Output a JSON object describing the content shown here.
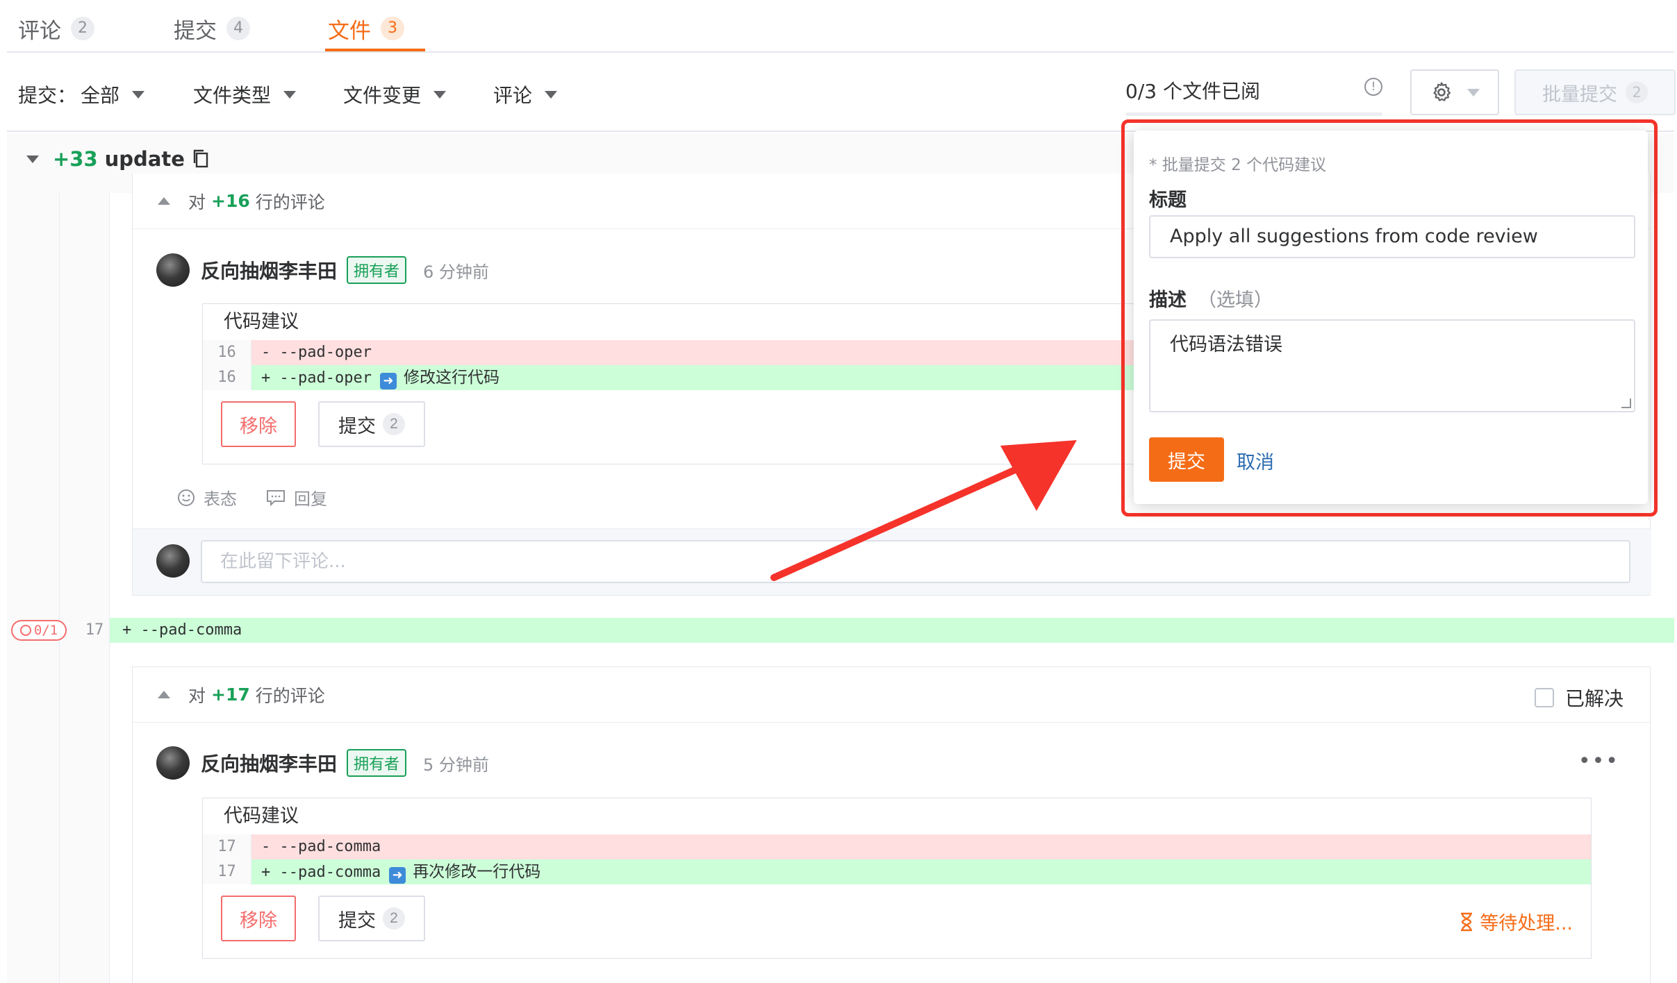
{
  "tabs": [
    {
      "label": "评论",
      "count": "2"
    },
    {
      "label": "提交",
      "count": "4"
    },
    {
      "label": "文件",
      "count": "3"
    }
  ],
  "filters": {
    "commit_label": "提交：",
    "commit_value": "全部",
    "file_type": "文件类型",
    "file_change": "文件变更",
    "comment": "评论"
  },
  "viewed_progress": "0/3 个文件已阅",
  "batch_submit": {
    "label": "批量提交",
    "count": "2"
  },
  "file": {
    "add_count": "+33",
    "name": "update"
  },
  "thread1": {
    "header_prefix": "对",
    "line_ref": "+16",
    "header_suffix": "行的评论",
    "author": "反向抽烟李丰田",
    "owner_tag": "拥有者",
    "time": "6 分钟前",
    "suggestion_title": "代码建议",
    "del_line_no": "16",
    "del_code": "- --pad-oper",
    "add_line_no": "16",
    "add_code": "+ --pad-oper",
    "add_note": "修改这行代码",
    "remove_label": "移除",
    "apply_label": "提交",
    "apply_count": "2",
    "react_label": "表态",
    "reply_label": "回复",
    "comment_placeholder": "在此留下评论..."
  },
  "diff_line": {
    "badge": "0/1",
    "line_no": "17",
    "code": "+ --pad-comma"
  },
  "thread2": {
    "header_prefix": "对",
    "line_ref": "+17",
    "header_suffix": "行的评论",
    "resolved_label": "已解决",
    "author": "反向抽烟李丰田",
    "owner_tag": "拥有者",
    "time": "5 分钟前",
    "suggestion_title": "代码建议",
    "del_line_no": "17",
    "del_code": "- --pad-comma",
    "add_line_no": "17",
    "add_code": "+ --pad-comma",
    "add_note": "再次修改一行代码",
    "remove_label": "移除",
    "apply_label": "提交",
    "apply_count": "2",
    "pending_label": "等待处理...",
    "react_label": "表态",
    "reply_label": "回复"
  },
  "popover": {
    "hint": "* 批量提交 2 个代码建议",
    "title_label": "标题",
    "title_value": "Apply all suggestions from code review",
    "desc_label": "描述",
    "desc_optional": "（选填）",
    "desc_value": "代码语法错误",
    "submit_label": "提交",
    "cancel_label": "取消"
  },
  "colors": {
    "accent": "#f56c17",
    "add_green": "#18a058",
    "danger": "#f56c6c",
    "annotation_red": "#f5332a"
  }
}
